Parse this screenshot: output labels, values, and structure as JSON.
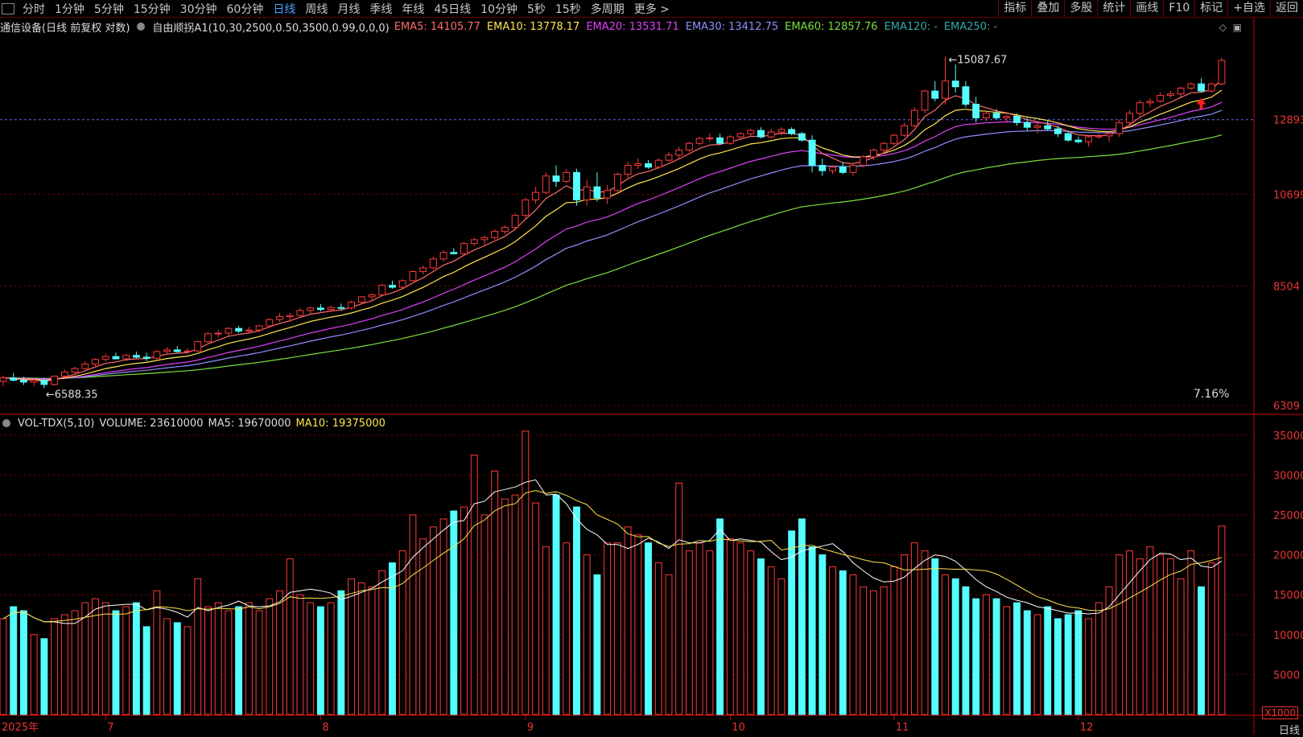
{
  "toolbar": {
    "left": [
      "分时",
      "1分钟",
      "5分钟",
      "15分钟",
      "30分钟",
      "60分钟",
      "日线",
      "周线",
      "月线",
      "季线",
      "年线",
      "45日线",
      "10分钟",
      "5秒",
      "15秒",
      "多周期",
      "更多 >"
    ],
    "active": "日线",
    "right": [
      "指标",
      "叠加",
      "多股",
      "统计",
      "画线",
      "F10",
      "标记",
      "+自选",
      "返回"
    ]
  },
  "price_header": {
    "title": "通信设备(日线 前复权 对数)",
    "indicator": "自由顺拐A1(10,30,2500,0.50,3500,0.99,0,0,0)",
    "emas": [
      {
        "label": "EMA5: 14105.77",
        "color": "#ff6b6b"
      },
      {
        "label": "EMA10: 13778.17",
        "color": "#ffe44d"
      },
      {
        "label": "EMA20: 13531.71",
        "color": "#e040fb"
      },
      {
        "label": "EMA30: 13412.75",
        "color": "#8f8fff"
      },
      {
        "label": "EMA60: 12857.76",
        "color": "#7dde3c"
      },
      {
        "label": "EMA120: -",
        "color": "#3aa"
      },
      {
        "label": "EMA250: -",
        "color": "#3aa"
      }
    ]
  },
  "vol_header": {
    "name": "VOL-TDX(5,10)",
    "volume": "VOLUME: 23610000",
    "ma5": "MA5: 19670000",
    "ma10": "MA10: 19375000"
  },
  "annotations": {
    "high": "15087.67",
    "low": "6588.35",
    "pct": "7.16%",
    "x1000": "X1000",
    "period": "日线",
    "year": "2025年"
  },
  "colors": {
    "up": "#ff3a3a",
    "down": "#55ffff",
    "grid": "#8a0000",
    "axis": "#e33"
  },
  "chart_data": {
    "type": "candlestick",
    "price_axis": {
      "scale": "log",
      "ticks": [
        6309,
        8504,
        10699,
        12893
      ],
      "last_marker": 12893
    },
    "volume_axis": {
      "ticks": [
        5000,
        10000,
        15000,
        20000,
        25000,
        30000,
        35000
      ],
      "unit": "X1000"
    },
    "x_month_labels": [
      {
        "index": 0,
        "label": "2025年"
      },
      {
        "index": 10,
        "label": "7"
      },
      {
        "index": 31,
        "label": "8"
      },
      {
        "index": 51,
        "label": "9"
      },
      {
        "index": 71,
        "label": "10"
      },
      {
        "index": 87,
        "label": "11"
      },
      {
        "index": 105,
        "label": "12"
      }
    ],
    "bars": [
      [
        6700,
        6800,
        6620,
        6760,
        12000
      ],
      [
        6760,
        6840,
        6700,
        6720,
        13500
      ],
      [
        6720,
        6780,
        6640,
        6690,
        13000
      ],
      [
        6690,
        6750,
        6620,
        6720,
        10000
      ],
      [
        6720,
        6760,
        6588,
        6650,
        9500
      ],
      [
        6650,
        6800,
        6630,
        6790,
        12000
      ],
      [
        6790,
        6900,
        6760,
        6860,
        12500
      ],
      [
        6860,
        6950,
        6820,
        6920,
        13000
      ],
      [
        6920,
        7050,
        6900,
        7000,
        14000
      ],
      [
        7000,
        7100,
        6950,
        7080,
        14500
      ],
      [
        7080,
        7180,
        7040,
        7130,
        14000
      ],
      [
        7130,
        7200,
        7080,
        7090,
        13000
      ],
      [
        7090,
        7180,
        7050,
        7150,
        13500
      ],
      [
        7150,
        7220,
        7100,
        7120,
        14000
      ],
      [
        7120,
        7200,
        7050,
        7100,
        11000
      ],
      [
        7100,
        7250,
        7080,
        7220,
        15500
      ],
      [
        7220,
        7300,
        7180,
        7250,
        12000
      ],
      [
        7250,
        7320,
        7200,
        7220,
        11500
      ],
      [
        7220,
        7280,
        7180,
        7230,
        11000
      ],
      [
        7230,
        7420,
        7210,
        7400,
        17000
      ],
      [
        7400,
        7580,
        7380,
        7550,
        13500
      ],
      [
        7550,
        7620,
        7480,
        7560,
        14000
      ],
      [
        7560,
        7680,
        7500,
        7650,
        13000
      ],
      [
        7650,
        7700,
        7560,
        7600,
        13500
      ],
      [
        7600,
        7680,
        7550,
        7620,
        14000
      ],
      [
        7620,
        7720,
        7580,
        7700,
        13000
      ],
      [
        7700,
        7850,
        7680,
        7820,
        14500
      ],
      [
        7820,
        7950,
        7780,
        7880,
        15500
      ],
      [
        7880,
        7950,
        7780,
        7900,
        19500
      ],
      [
        7900,
        8050,
        7880,
        8000,
        15000
      ],
      [
        8000,
        8080,
        7920,
        8050,
        14000
      ],
      [
        8050,
        8130,
        7980,
        8020,
        13500
      ],
      [
        8020,
        8100,
        7970,
        8060,
        14000
      ],
      [
        8060,
        8140,
        8000,
        8050,
        15500
      ],
      [
        8050,
        8200,
        8020,
        8170,
        17000
      ],
      [
        8170,
        8300,
        8140,
        8280,
        16500
      ],
      [
        8280,
        8350,
        8200,
        8320,
        16000
      ],
      [
        8320,
        8550,
        8300,
        8520,
        18000
      ],
      [
        8520,
        8620,
        8450,
        8480,
        19000
      ],
      [
        8480,
        8650,
        8460,
        8620,
        20500
      ],
      [
        8620,
        8850,
        8600,
        8820,
        25000
      ],
      [
        8820,
        8950,
        8760,
        8900,
        22000
      ],
      [
        8900,
        9150,
        8880,
        9100,
        23500
      ],
      [
        9100,
        9300,
        9050,
        9250,
        24500
      ],
      [
        9250,
        9350,
        9200,
        9220,
        25500
      ],
      [
        9220,
        9500,
        9200,
        9460,
        26000
      ],
      [
        9460,
        9600,
        9400,
        9550,
        32500
      ],
      [
        9550,
        9650,
        9420,
        9600,
        25000
      ],
      [
        9600,
        9800,
        9550,
        9750,
        30500
      ],
      [
        9750,
        9900,
        9680,
        9850,
        27000
      ],
      [
        9850,
        10200,
        9800,
        10150,
        27500
      ],
      [
        10150,
        10600,
        10080,
        10550,
        35500
      ],
      [
        10550,
        10900,
        10450,
        10750,
        26500
      ],
      [
        10750,
        11300,
        10700,
        11200,
        21000
      ],
      [
        11200,
        11500,
        10900,
        11050,
        27500
      ],
      [
        11050,
        11400,
        11000,
        11300,
        21500
      ],
      [
        11300,
        11400,
        10400,
        10550,
        26000
      ],
      [
        10550,
        11100,
        10400,
        10900,
        20000
      ],
      [
        10900,
        11300,
        10500,
        10600,
        17500
      ],
      [
        10600,
        10950,
        10450,
        10800,
        21500
      ],
      [
        10800,
        11300,
        10700,
        11250,
        21500
      ],
      [
        11250,
        11600,
        11150,
        11500,
        23500
      ],
      [
        11500,
        11700,
        11400,
        11550,
        22500
      ],
      [
        11550,
        11650,
        11400,
        11450,
        21500
      ],
      [
        11450,
        11700,
        11400,
        11650,
        19000
      ],
      [
        11650,
        11900,
        11600,
        11800,
        17500
      ],
      [
        11800,
        12050,
        11700,
        11950,
        29000
      ],
      [
        11950,
        12200,
        11900,
        12150,
        20500
      ],
      [
        12150,
        12350,
        12100,
        12300,
        21500
      ],
      [
        12300,
        12450,
        12200,
        12320,
        20500
      ],
      [
        12320,
        12450,
        12100,
        12150,
        24500
      ],
      [
        12150,
        12400,
        12100,
        12350,
        22000
      ],
      [
        12350,
        12500,
        12250,
        12450,
        21500
      ],
      [
        12450,
        12600,
        12350,
        12550,
        20500
      ],
      [
        12550,
        12650,
        12300,
        12350,
        19500
      ],
      [
        12350,
        12600,
        12300,
        12500,
        18500
      ],
      [
        12500,
        12650,
        12400,
        12580,
        17000
      ],
      [
        12580,
        12650,
        12400,
        12450,
        23000
      ],
      [
        12450,
        12500,
        12200,
        12250,
        24500
      ],
      [
        12250,
        12400,
        11300,
        11500,
        21000
      ],
      [
        11500,
        11700,
        11200,
        11350,
        20000
      ],
      [
        11350,
        11500,
        11250,
        11450,
        18500
      ],
      [
        11450,
        11600,
        11250,
        11300,
        18000
      ],
      [
        11300,
        11550,
        11200,
        11500,
        17500
      ],
      [
        11500,
        11800,
        11450,
        11750,
        16000
      ],
      [
        11750,
        12000,
        11650,
        11950,
        15500
      ],
      [
        11950,
        12200,
        11850,
        12150,
        16000
      ],
      [
        12150,
        12450,
        12100,
        12400,
        18500
      ],
      [
        12400,
        12800,
        12350,
        12700,
        20000
      ],
      [
        12700,
        13300,
        12650,
        13200,
        21500
      ],
      [
        13200,
        13900,
        13100,
        13850,
        20500
      ],
      [
        13850,
        14200,
        13500,
        13600,
        19500
      ],
      [
        13600,
        15087,
        13400,
        14200,
        17500
      ],
      [
        14200,
        14800,
        13800,
        14000,
        17000
      ],
      [
        14000,
        14200,
        13300,
        13400,
        16000
      ],
      [
        13400,
        13650,
        12800,
        12950,
        14500
      ],
      [
        12950,
        13200,
        12850,
        13100,
        15000
      ],
      [
        13100,
        13250,
        12900,
        12950,
        14500
      ],
      [
        12950,
        13050,
        12800,
        13000,
        13500
      ],
      [
        13000,
        13100,
        12700,
        12800,
        14000
      ],
      [
        12800,
        12950,
        12550,
        12650,
        13000
      ],
      [
        12650,
        12800,
        12450,
        12700,
        12500
      ],
      [
        12700,
        12850,
        12550,
        12600,
        13500
      ],
      [
        12600,
        12700,
        12350,
        12450,
        12000
      ],
      [
        12450,
        12550,
        12200,
        12250,
        12500
      ],
      [
        12250,
        12350,
        12150,
        12200,
        13000
      ],
      [
        12200,
        12400,
        12050,
        12350,
        12000
      ],
      [
        12350,
        12450,
        12300,
        12380,
        14000
      ],
      [
        12380,
        12500,
        12200,
        12450,
        16000
      ],
      [
        12450,
        12900,
        12350,
        12800,
        20000
      ],
      [
        12800,
        13200,
        12750,
        13100,
        20500
      ],
      [
        13100,
        13550,
        13000,
        13450,
        19500
      ],
      [
        13450,
        13600,
        13300,
        13500,
        21000
      ],
      [
        13500,
        13800,
        13450,
        13700,
        20000
      ],
      [
        13700,
        13850,
        13600,
        13750,
        19500
      ],
      [
        13750,
        14000,
        13650,
        13950,
        17000
      ],
      [
        13950,
        14150,
        13900,
        14100,
        20500
      ],
      [
        14100,
        14300,
        13800,
        13850,
        16000
      ],
      [
        13850,
        14150,
        13800,
        14100,
        19000
      ],
      [
        14100,
        15050,
        14050,
        14950,
        23610
      ]
    ]
  }
}
